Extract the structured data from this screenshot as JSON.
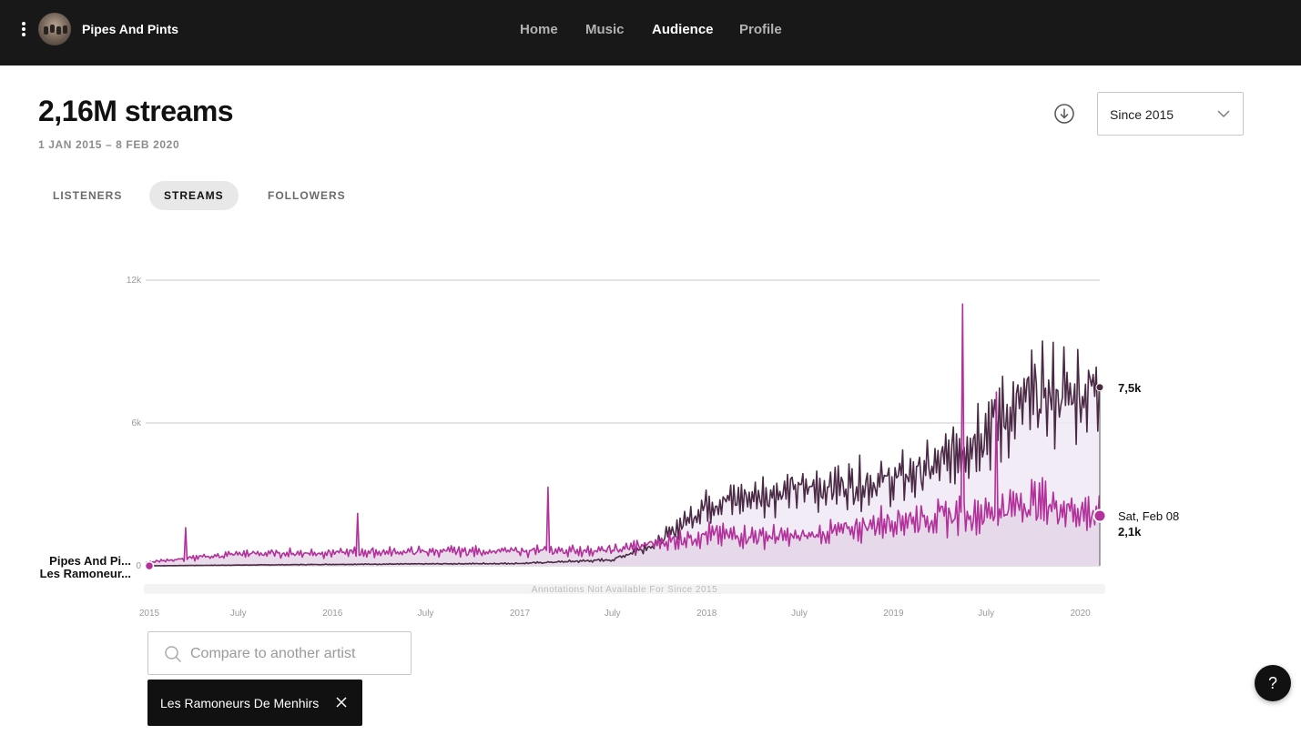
{
  "header": {
    "artist_name": "Pipes And Pints",
    "nav": [
      {
        "label": "Home",
        "active": false
      },
      {
        "label": "Music",
        "active": false
      },
      {
        "label": "Audience",
        "active": true
      },
      {
        "label": "Profile",
        "active": false
      }
    ]
  },
  "summary": {
    "headline": "2,16M streams",
    "date_range": "1 JAN 2015 – 8 FEB 2020"
  },
  "controls": {
    "download_icon": "download-circle-icon",
    "range_value": "Since 2015"
  },
  "tabs": [
    {
      "label": "LISTENERS",
      "active": false
    },
    {
      "label": "STREAMS",
      "active": true
    },
    {
      "label": "FOLLOWERS",
      "active": false
    }
  ],
  "chart_data": {
    "type": "line",
    "y_ticks": [
      "0",
      "6k",
      "12k"
    ],
    "ylim": [
      0,
      12000
    ],
    "x_ticks": [
      "2015",
      "July",
      "2016",
      "July",
      "2017",
      "July",
      "2018",
      "July",
      "2019",
      "July",
      "2020"
    ],
    "x_range": [
      "2015-01-01",
      "2020-02-08"
    ],
    "grid": true,
    "annotation_note": "Annotations Not Available For Since 2015",
    "series": [
      {
        "name": "Pipes And Pi...",
        "color": "#4a2a45",
        "end_label": "7,5k",
        "points": [
          [
            "2015-01-01",
            0
          ],
          [
            "2015-07-01",
            30
          ],
          [
            "2016-01-01",
            60
          ],
          [
            "2016-07-01",
            80
          ],
          [
            "2017-01-01",
            100
          ],
          [
            "2017-07-01",
            250
          ],
          [
            "2017-10-01",
            1000
          ],
          [
            "2018-01-01",
            2600
          ],
          [
            "2018-07-01",
            3200
          ],
          [
            "2018-10-01",
            3400
          ],
          [
            "2019-01-01",
            3600
          ],
          [
            "2019-04-01",
            4200
          ],
          [
            "2019-07-01",
            5800
          ],
          [
            "2019-10-01",
            7000
          ],
          [
            "2020-01-01",
            7300
          ],
          [
            "2020-02-08",
            7500
          ]
        ]
      },
      {
        "name": "Les Ramoneur...",
        "color": "#b2319b",
        "end_label": "2,1k",
        "points": [
          [
            "2015-01-01",
            150
          ],
          [
            "2015-07-01",
            500
          ],
          [
            "2016-01-01",
            550
          ],
          [
            "2016-07-01",
            600
          ],
          [
            "2017-01-01",
            620
          ],
          [
            "2017-07-01",
            650
          ],
          [
            "2018-01-01",
            1300
          ],
          [
            "2018-07-01",
            1200
          ],
          [
            "2018-10-01",
            1500
          ],
          [
            "2019-01-01",
            1900
          ],
          [
            "2019-07-01",
            2200
          ],
          [
            "2019-10-01",
            2700
          ],
          [
            "2020-01-01",
            2300
          ],
          [
            "2020-02-08",
            2100
          ]
        ],
        "spikes": [
          [
            "2015-03-20",
            1600
          ],
          [
            "2016-02-20",
            2200
          ],
          [
            "2017-02-25",
            3300
          ],
          [
            "2019-05-15",
            11000
          ],
          [
            "2019-07-20",
            7300
          ]
        ]
      }
    ],
    "tooltip_date": "Sat, Feb 08"
  },
  "compare": {
    "placeholder": "Compare to another artist",
    "chip_label": "Les Ramoneurs De Menhirs"
  },
  "help": {
    "label": "?"
  }
}
